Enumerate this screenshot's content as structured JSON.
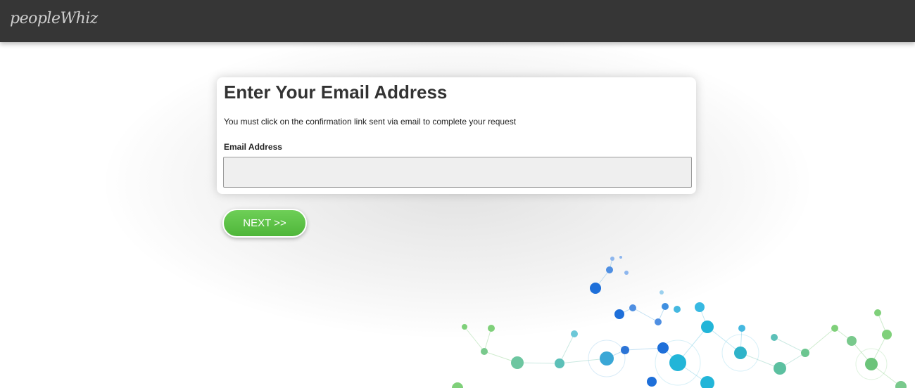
{
  "header": {
    "logo_text": "peopleWhiz"
  },
  "form": {
    "title": "Enter Your Email Address",
    "subtitle": "You must click on the confirmation link sent via email to complete your request",
    "email_label": "Email Address",
    "email_value": "",
    "email_placeholder": "",
    "next_label": "NEXT >>"
  },
  "colors": {
    "header_bg": "#363636",
    "button_green": "#5cc246",
    "node_blue": "#1e6fd9",
    "node_cyan": "#22b5d8",
    "node_green": "#5cbf5a"
  },
  "decoration": {
    "icon": "network-graph-illustration"
  }
}
